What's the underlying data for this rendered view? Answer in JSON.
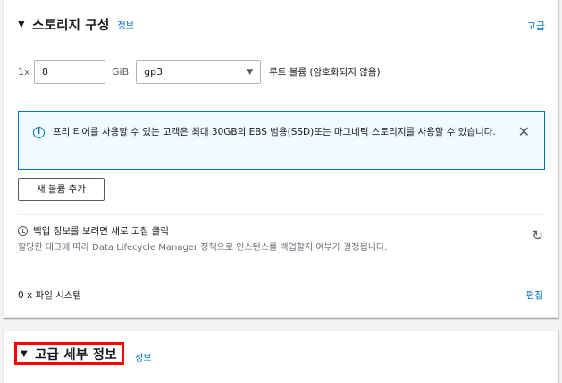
{
  "storage_section": {
    "title": "스토리지 구성",
    "info_link": "정보",
    "advanced_link": "고급",
    "volume": {
      "multiplier": "1x",
      "size_value": "8",
      "unit": "GiB",
      "volume_type": "gp3",
      "description": "루트 볼륨 (암호화되지 않음)"
    },
    "alert": {
      "text": "프리 티어를 사용할 수 있는 고객은 최대 30GB의 EBS 범용(SSD)또는 마그네틱 스토리지를 사용할 수 있습니다."
    },
    "add_volume_button": "새 볼륨 추가",
    "backup": {
      "title": "백업 정보를 보려면 새로 고침 클릭",
      "description": "할당한 태그에 따라 Data Lifecycle Manager 정책으로 인스턴스를 백업할지 여부가 결정됩니다."
    },
    "file_systems": "0 x 파일 시스템",
    "edit_link": "편집"
  },
  "advanced_section": {
    "title": "고급 세부 정보",
    "info_link": "정보"
  },
  "colors": {
    "link": "#0073bb",
    "alert_border": "#0073bb",
    "alert_bg": "#f1faff",
    "highlight": "#ff0000"
  },
  "icons": [
    "caret-down-icon",
    "info-icon",
    "close-icon",
    "clock-icon",
    "refresh-icon",
    "select-arrow-icon"
  ]
}
